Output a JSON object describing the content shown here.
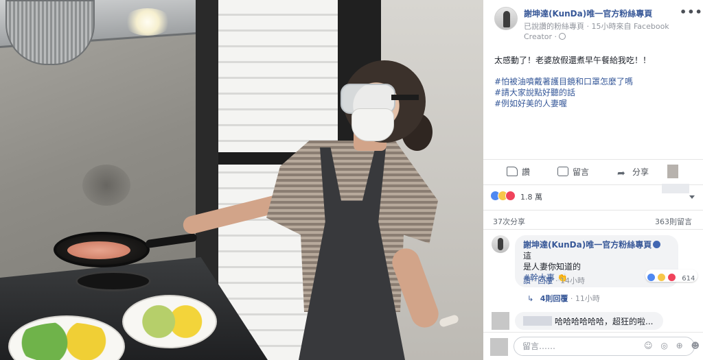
{
  "post": {
    "page_name": "謝坤達(KunDa)唯一官方粉絲專頁",
    "meta_line1": "已說讚的粉絲專頁 · 15小時來自 Facebook",
    "meta_line2": "Creator ·",
    "text_line1": "太感動了！老婆放假還煮早午餐給我吃！！",
    "hashtags": [
      "#怕被油噴戴著護目鏡和口罩怎麼了嗎",
      "#請大家說點好聽的話",
      "#例如好美的人妻喔"
    ]
  },
  "actions": {
    "like": "讚",
    "comment": "留言",
    "share": "分享"
  },
  "stats": {
    "reactions": "1.8 萬",
    "shares": "37次分享",
    "comments": "363則留言"
  },
  "top_comment": {
    "author": "謝坤達(KunDa)唯一官方粉絲專頁",
    "text_line1": "這",
    "text_line2": "是人妻你知道的",
    "tag": "#幹大事",
    "emoji": "👏",
    "reaction_count": "614",
    "like_link": "讚",
    "reply_link": "回覆",
    "time": "14小時",
    "replies_label": "4則回覆",
    "replies_time": "11小時",
    "reply_arrow": "↳"
  },
  "second_comment": {
    "text": "哈哈哈哈哈哈，超狂的啦..."
  },
  "composer": {
    "placeholder": "留言……",
    "icons": "☺ ◎ ⊕ ☻"
  },
  "colors": {
    "link": "#385898",
    "like_blue": "#4f88f1",
    "haha_yellow": "#f7c74a",
    "love_red": "#f0435b"
  }
}
